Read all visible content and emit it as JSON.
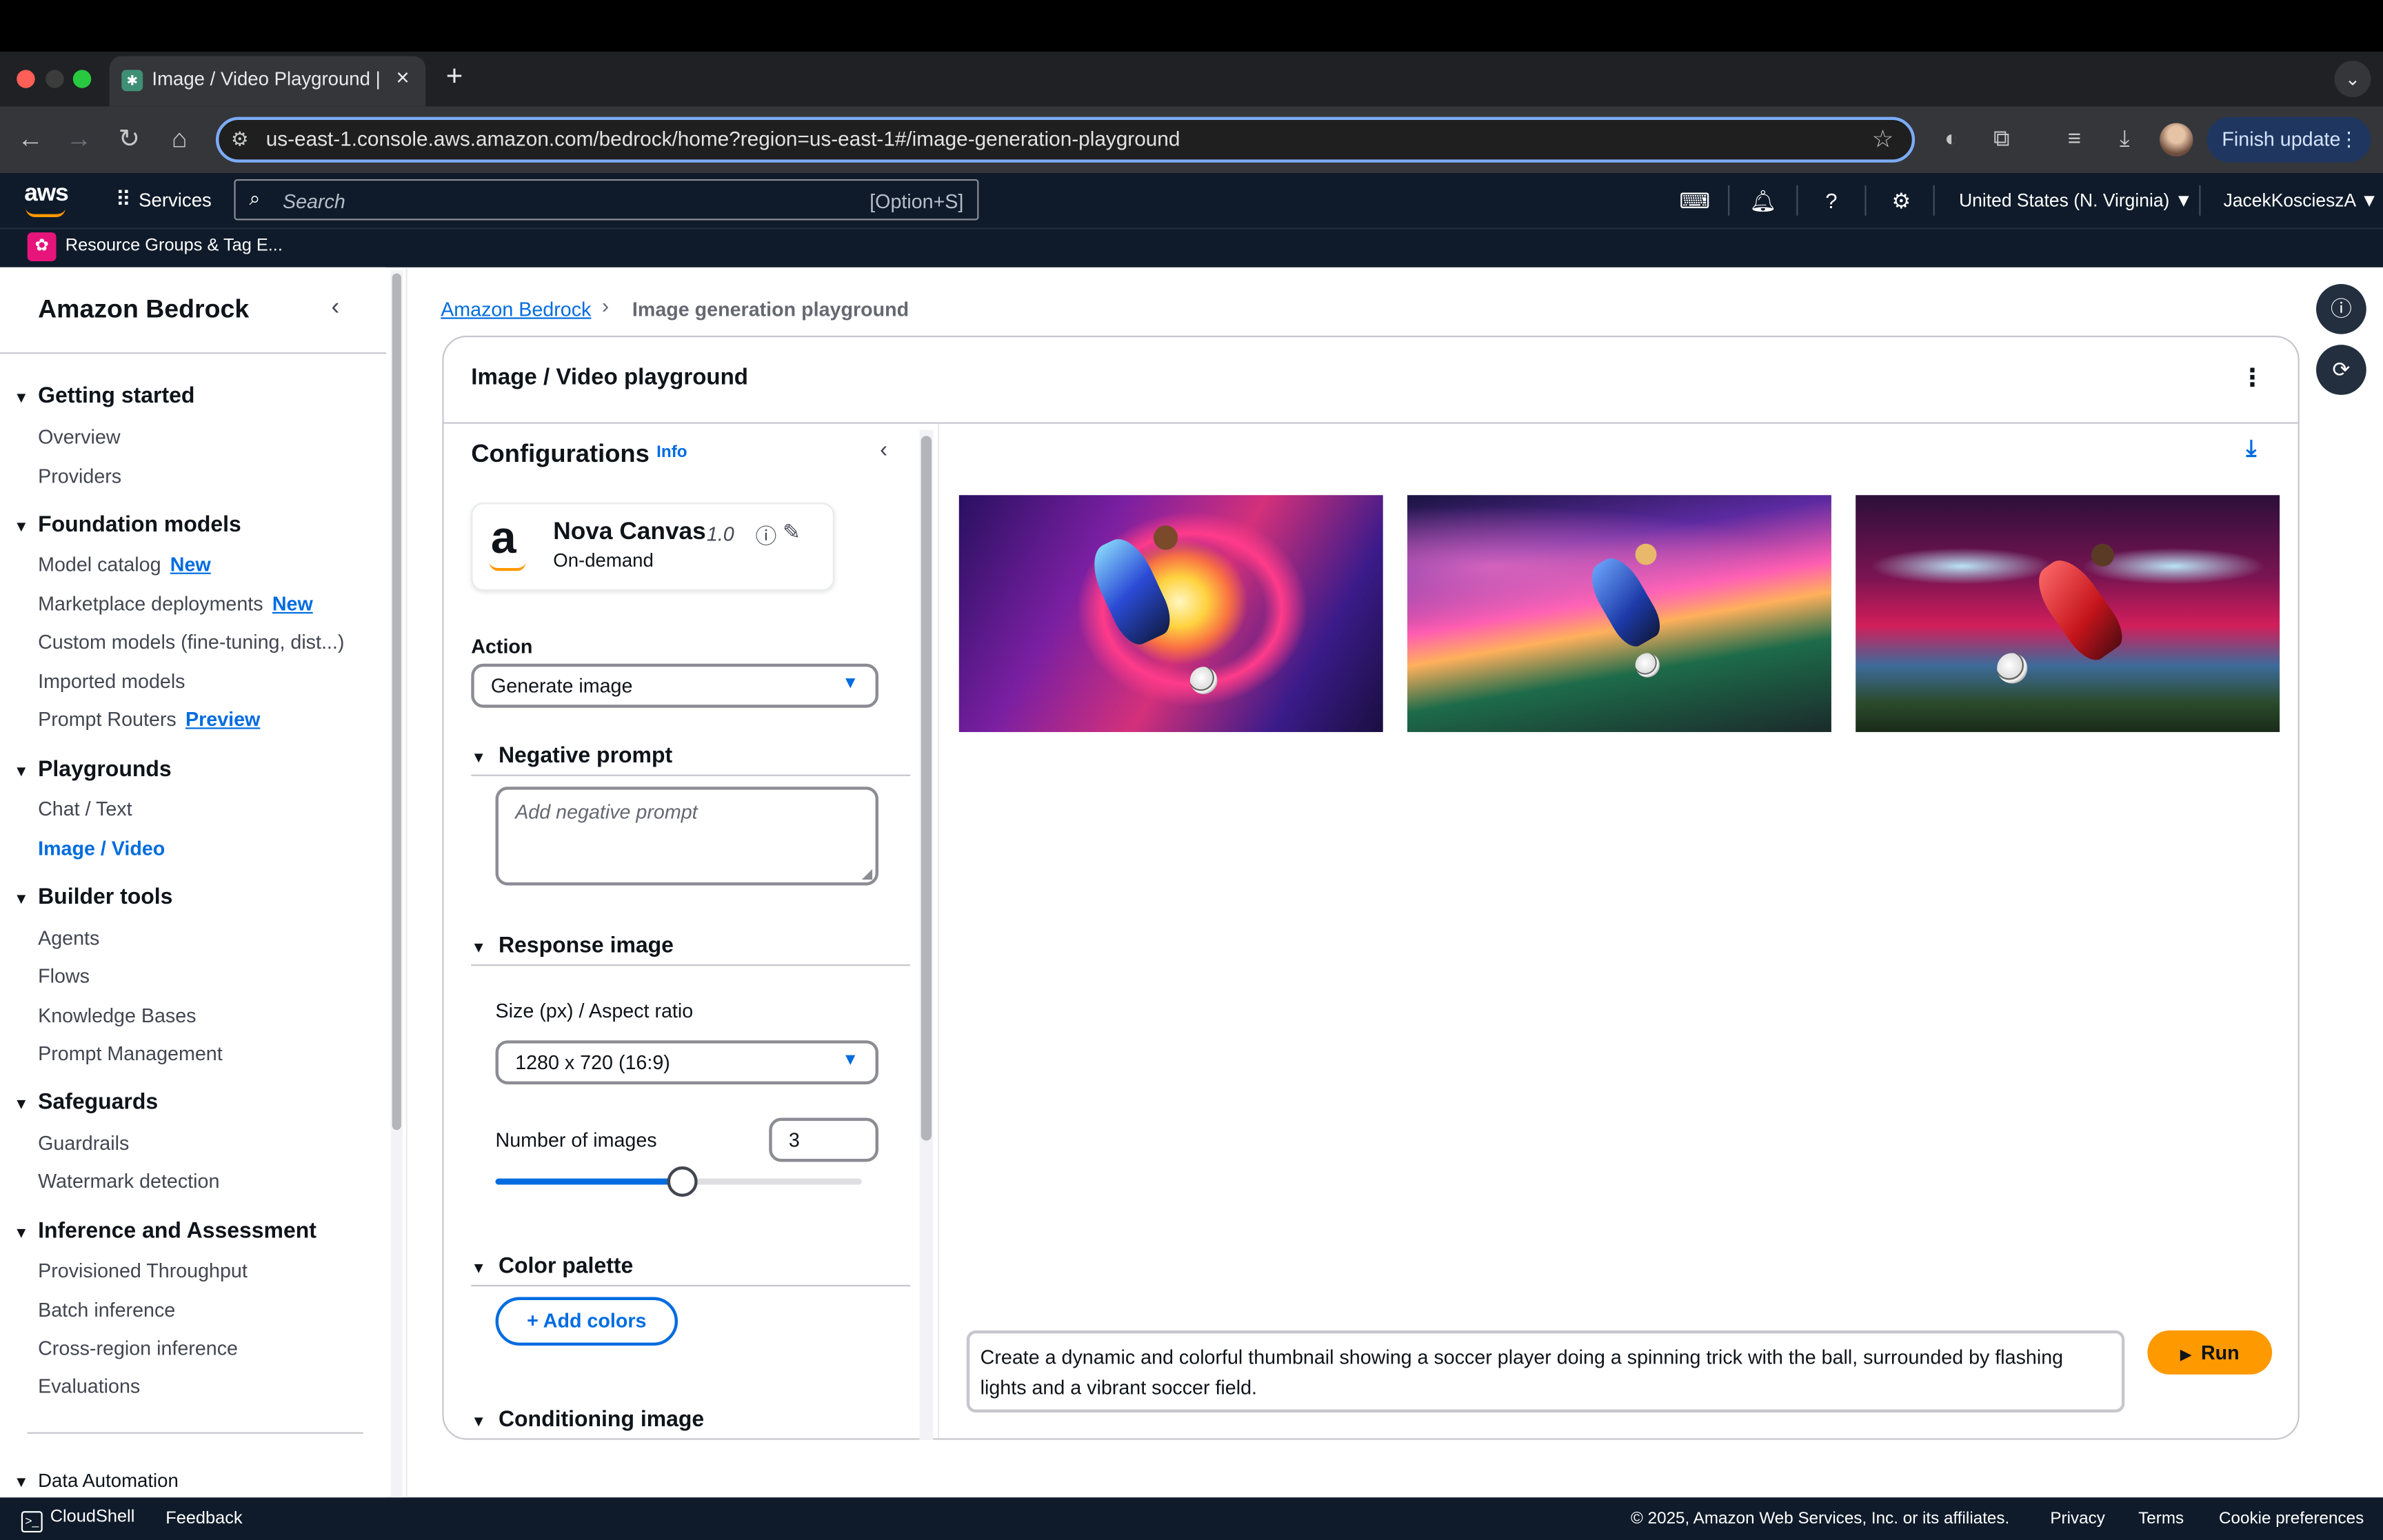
{
  "browser": {
    "tab_title": "Image / Video Playground | Amazon Bedrock",
    "new_tab": "+",
    "url": "us-east-1.console.aws.amazon.com/bedrock/home?region=us-east-1#/image-generation-playground",
    "finish_update": "Finish update"
  },
  "awsnav": {
    "logo": "aws",
    "services": "Services",
    "search_placeholder": "Search",
    "search_shortcut": "[Option+S]",
    "region": "United States (N. Virginia) ▼",
    "user": "JacekKoscieszA ▼",
    "favorites": [
      {
        "label": "Resource Groups & Tag E..."
      }
    ]
  },
  "sidenav": {
    "title": "Amazon Bedrock",
    "sections": [
      {
        "title": "Getting started",
        "items": [
          "Overview",
          "Providers"
        ]
      },
      {
        "title": "Foundation models",
        "items": [
          "Model catalog",
          "Marketplace deployments",
          "Custom models (fine-tuning, dist...)",
          "Imported models",
          "Prompt Routers"
        ]
      },
      {
        "title": "Playgrounds",
        "items": [
          "Chat / Text",
          "Image / Video"
        ]
      },
      {
        "title": "Builder tools",
        "items": [
          "Agents",
          "Flows",
          "Knowledge Bases",
          "Prompt Management"
        ]
      },
      {
        "title": "Safeguards",
        "items": [
          "Guardrails",
          "Watermark detection"
        ]
      },
      {
        "title": "Inference and Assessment",
        "items": [
          "Provisioned Throughput",
          "Batch inference",
          "Cross-region inference",
          "Evaluations"
        ]
      },
      {
        "title": "Data Automation",
        "items": []
      }
    ],
    "badges": {
      "model_catalog": "New",
      "marketplace": "New",
      "prompt_routers": "Preview"
    }
  },
  "breadcrumb": {
    "root": "Amazon Bedrock",
    "current": "Image generation playground"
  },
  "playground": {
    "title": "Image / Video playground",
    "config": {
      "title": "Configurations",
      "info": "Info",
      "model_name": "Nova Canvas",
      "model_version": "1.0",
      "model_mode": "On-demand",
      "action_label": "Action",
      "action_value": "Generate image",
      "negative_prompt_title": "Negative prompt",
      "negative_prompt_placeholder": "Add negative prompt",
      "response_image_title": "Response image",
      "size_label": "Size (px) / Aspect ratio",
      "size_value": "1280 x 720 (16:9)",
      "num_images_label": "Number of images",
      "num_images_value": "3",
      "num_images_slider_fraction": 0.5,
      "color_palette_title": "Color palette",
      "add_colors": "+ Add colors",
      "conditioning_title": "Conditioning image"
    },
    "prompt": "Create a dynamic and colorful thumbnail showing a soccer player doing a spinning trick with the ball, surrounded by flashing lights and a vibrant soccer field.",
    "run": "Run"
  },
  "footer": {
    "cloudshell": "CloudShell",
    "feedback": "Feedback",
    "copyright": "© 2025, Amazon Web Services, Inc. or its affiliates.",
    "privacy": "Privacy",
    "terms": "Terms",
    "cookies": "Cookie preferences"
  },
  "colors": {
    "accent": "#006ce0",
    "run_button": "#ff9900",
    "aws_nav": "#0f1b2a"
  }
}
